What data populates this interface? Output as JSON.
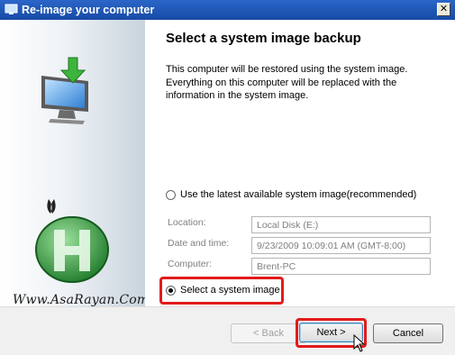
{
  "window": {
    "title": "Re-image your computer",
    "close_symbol": "✕"
  },
  "sidebar": {
    "monitor_icon": "monitor-restore-icon",
    "logo_icon": "asarayan-logo-icon",
    "watermark": "Www.AsaRayan.Com"
  },
  "main": {
    "heading": "Select a system image backup",
    "description": "This computer will be restored using the system image. Everything on this computer will be replaced with the information in the system image.",
    "option_latest": {
      "label": "Use the latest available system image(recommended)",
      "checked": false
    },
    "fields": [
      {
        "label": "Location:",
        "value": "Local Disk (E:)"
      },
      {
        "label": "Date and time:",
        "value": "9/23/2009 10:09:01 AM (GMT-8:00)"
      },
      {
        "label": "Computer:",
        "value": "Brent-PC"
      }
    ],
    "option_select": {
      "label": "Select a system image",
      "checked": true
    }
  },
  "footer": {
    "back_label": "< Back",
    "next_label": "Next >",
    "cancel_label": "Cancel"
  },
  "colors": {
    "highlight": "#e21b1b",
    "titlebar": "#2a66c8"
  }
}
